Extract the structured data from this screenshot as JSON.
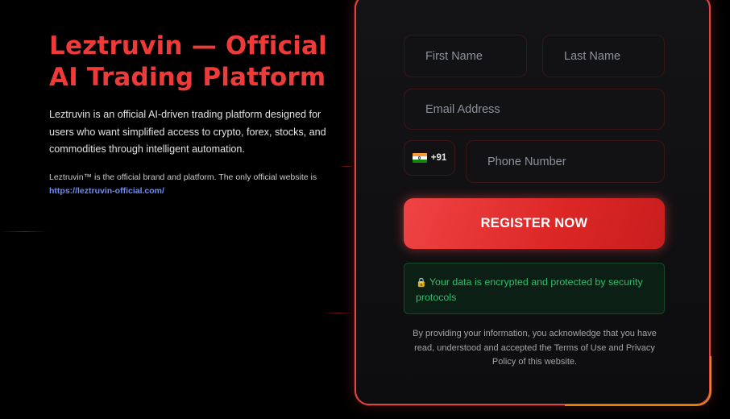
{
  "hero": {
    "title": "Leztruvin — Official AI Trading Platform",
    "description": "Leztruvin is an official AI-driven trading platform designed for users who want simplified access to crypto, forex, stocks, and commodities through intelligent automation.",
    "note": "Leztruvin™ is the official brand and platform. The only official website is",
    "link": "https://leztruvin-official.com/"
  },
  "form": {
    "first_name_placeholder": "First Name",
    "last_name_placeholder": "Last Name",
    "email_placeholder": "Email Address",
    "country_code": "+91",
    "country_flag_icon": "india-flag-icon",
    "phone_placeholder": "Phone Number",
    "submit_label": "REGISTER NOW",
    "security_icon": "lock-icon",
    "security_icon_glyph": "🔒",
    "security_text": "Your data is encrypted and protected by security protocols",
    "consent_text": "By providing your information, you acknowledge that you have read, understood and accepted the Terms of Use and Privacy Policy of this website."
  },
  "colors": {
    "accent": "#ef4444",
    "link": "#6d8cff",
    "success": "#2fbf6b",
    "background": "#000000"
  }
}
